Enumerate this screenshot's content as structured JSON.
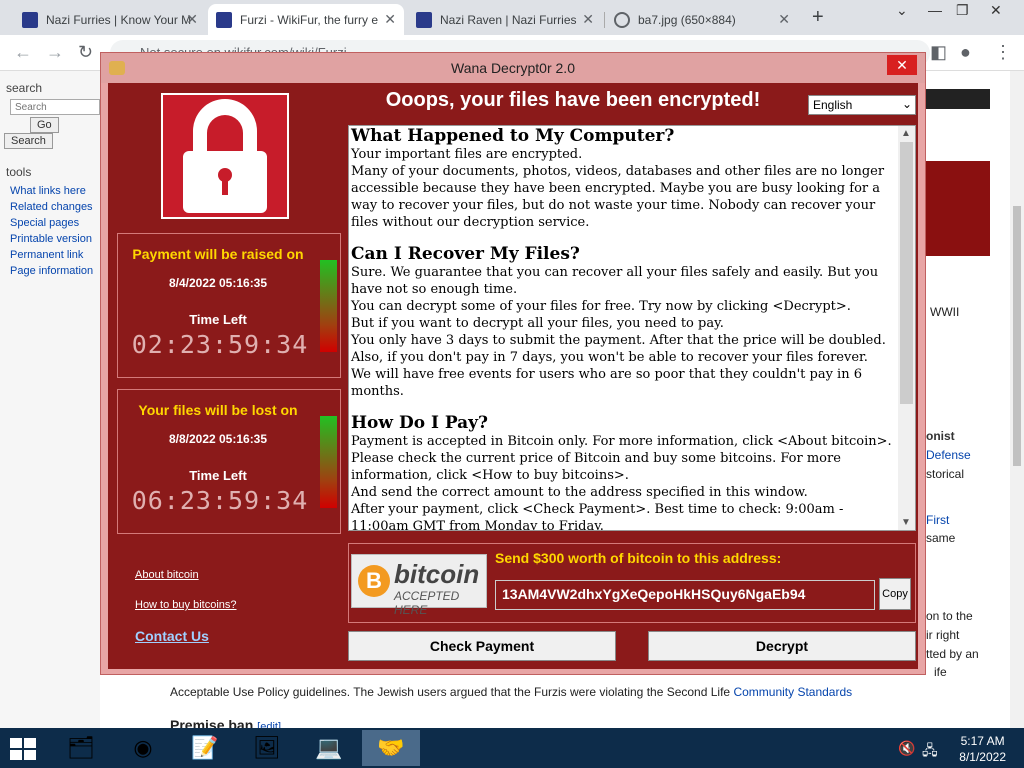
{
  "browser": {
    "tabs": [
      {
        "title": "Nazi Furries | Know Your M"
      },
      {
        "title": "Furzi - WikiFur, the furry e"
      },
      {
        "title": "Nazi Raven | Nazi Furries"
      },
      {
        "title": "ba7.jpg (650×884)"
      }
    ],
    "new_tab": "+",
    "address": "Not secure   en.wikifur.com/wiki/Furzi"
  },
  "wiki": {
    "search_header": "search",
    "search_placeholder": "Search",
    "go": "Go",
    "search_btn": "Search",
    "tools_header": "tools",
    "tools": [
      "What links here",
      "Related changes",
      "Special pages",
      "Printable version",
      "Permanent link",
      "Page information"
    ],
    "wwii": "WWII",
    "text_a": "onist",
    "text_b": "Defense",
    "text_c": "storical",
    "text_d": "First",
    "text_e": "same",
    "text_f": "on to the",
    "text_g": "ir right",
    "text_h": "tted by an",
    "text_i": "ife",
    "footer_line": "Acceptable Use Policy guidelines. The Jewish users argued that the Furzis were violating the Second Life",
    "footer_link": "Community Standards",
    "premise": "Premise ban",
    "edit": "[edit]"
  },
  "wana": {
    "title": "Wana Decrypt0r 2.0",
    "close": "✕",
    "headline": "Ooops, your files have been encrypted!",
    "language": "English",
    "raise": {
      "head": "Payment will be raised on",
      "date": "8/4/2022 05:16:35",
      "label": "Time Left",
      "count": "02:23:59:34"
    },
    "lost": {
      "head": "Your files will be lost on",
      "date": "8/8/2022 05:16:35",
      "label": "Time Left",
      "count": "06:23:59:34"
    },
    "links": {
      "about": "About bitcoin",
      "how": "How to buy bitcoins?",
      "contact": "Contact Us"
    },
    "message": {
      "s1_title": "What Happened to My Computer?",
      "s1_p1": "Your important files are encrypted.",
      "s1_p2": "Many of your documents, photos, videos, databases and other files are no longer accessible because they have been encrypted. Maybe you are busy looking for a way to recover your files, but do not waste your time. Nobody can recover your files without our decryption service.",
      "s2_title": "Can I Recover My Files?",
      "s2_p1": "Sure. We guarantee that you can recover all your files safely and easily. But you have not so enough time.",
      "s2_p2": "You can decrypt some of your files for free. Try now by clicking <Decrypt>.",
      "s2_p3": "But if you want to decrypt all your files, you need to pay.",
      "s2_p4": "You only have 3 days to submit the payment. After that the price will be doubled.",
      "s2_p5": "Also, if you don't pay in 7 days, you won't be able to recover your files forever.",
      "s2_p6": "We will have free events for users who are so poor that they couldn't pay in 6 months.",
      "s3_title": "How Do I Pay?",
      "s3_p1": "Payment is accepted in Bitcoin only. For more information, click <About bitcoin>.",
      "s3_p2": "Please check the current price of Bitcoin and buy some bitcoins. For more information, click <How to buy bitcoins>.",
      "s3_p3": "And send the correct amount to the address specified in this window.",
      "s3_p4": "After your payment, click <Check Payment>. Best time to check: 9:00am - 11:00am GMT from Monday to Friday."
    },
    "bitcoin_word": "bitcoin",
    "bitcoin_accepted": "ACCEPTED HERE",
    "bitcoin_symbol": "B",
    "send_label": "Send $300 worth of bitcoin to this address:",
    "address": "13AM4VW2dhxYgXeQepoHkHSQuy6NgaEb94",
    "copy": "Copy",
    "check_payment": "Check Payment",
    "decrypt": "Decrypt"
  },
  "taskbar": {
    "time": "5:17 AM",
    "date": "8/1/2022"
  }
}
